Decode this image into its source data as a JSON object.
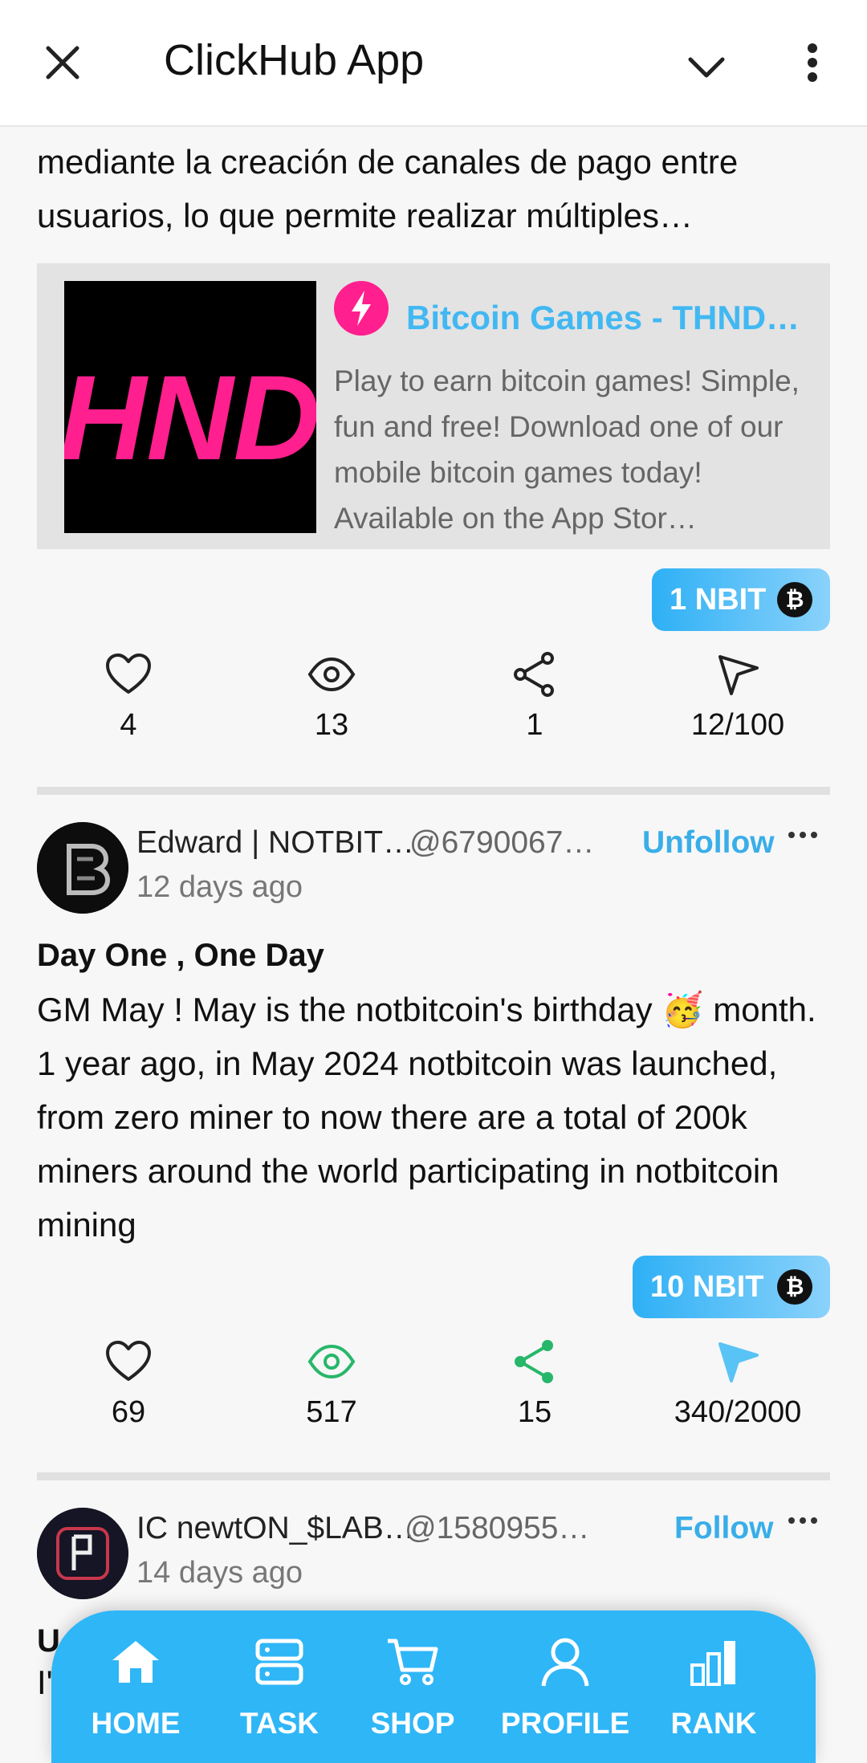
{
  "header": {
    "title": "ClickHub App"
  },
  "post_prev": {
    "snippet_line1": "mediante la creación de canales de pago entre",
    "snippet_line2": "usuarios, lo que permite realizar múltiples…",
    "link": {
      "thumb_text": "HNDI",
      "title": "Bitcoin Games - THND…",
      "description": "Play to earn bitcoin games! Simple, fun and free! Download one of our mobile bitcoin games today! Available on the App Stor…"
    },
    "reward": "1 NBIT",
    "stats": {
      "likes": "4",
      "views": "13",
      "shares": "1",
      "sends": "12/100"
    }
  },
  "post_main": {
    "user": "Edward | NOTBIT…",
    "handle": "@6790067…",
    "follow_label": "Unfollow",
    "time": "12 days ago",
    "title": "Day One , One Day",
    "body": "GM May ! May is the notbitcoin's birthday 🥳 month. 1 year ago, in May 2024 notbitcoin was launched, from zero miner to now there are a total of 200k miners around the world participating in notbitcoin mining",
    "reward": "10 NBIT",
    "stats": {
      "likes": "69",
      "views": "517",
      "shares": "15",
      "sends": "340/2000"
    }
  },
  "post_next": {
    "user": "IC newtON_$LAB…",
    "handle": "@1580955…",
    "follow_label": "Follow",
    "time": "14 days ago",
    "title_partial": "U",
    "body_partial": "I'"
  },
  "nav": {
    "home": "HOME",
    "task": "TASK",
    "shop": "SHOP",
    "profile": "PROFILE",
    "rank": "RANK"
  },
  "colors": {
    "accent": "#2fb6f7",
    "link_title": "#42b8f2",
    "green_active": "#27b76a",
    "thumb_pink": "#ff1f8e"
  }
}
